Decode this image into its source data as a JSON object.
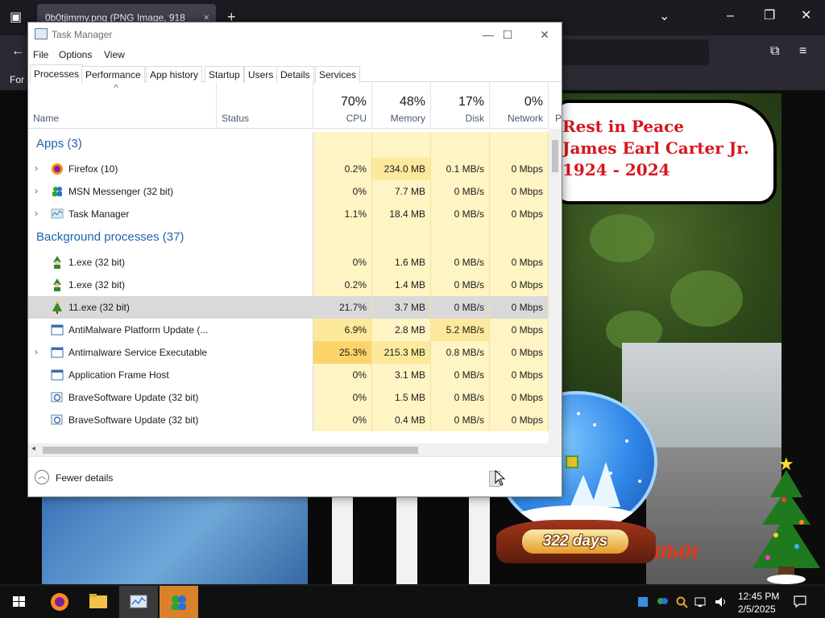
{
  "browser": {
    "tab_title": "0b0tjimmy.png (PNG Image, 918",
    "tab_close": "×",
    "new_tab": "+",
    "bookmark_text": "For"
  },
  "image": {
    "bubble_lines": [
      "Rest in Peace",
      "James Earl Carter Jr.",
      "1924 - 2024"
    ],
    "globe_label": "322 days",
    "signature": "0b0t"
  },
  "taskmgr": {
    "title": "Task Manager",
    "window_controls": {
      "minimize": "—",
      "maximize": "☐",
      "close": "✕"
    },
    "menu": [
      "File",
      "Options",
      "View"
    ],
    "tabs": [
      "Processes",
      "Performance",
      "App history",
      "Startup",
      "Users",
      "Details",
      "Services"
    ],
    "active_tab": "Processes",
    "header": {
      "sort_arrow": "^",
      "name": "Name",
      "status": "Status",
      "cpu": {
        "pct": "70%",
        "label": "CPU"
      },
      "memory": {
        "pct": "48%",
        "label": "Memory"
      },
      "disk": {
        "pct": "17%",
        "label": "Disk"
      },
      "network": {
        "pct": "0%",
        "label": "Network"
      },
      "power_partial": "P"
    },
    "groups": {
      "apps": "Apps (3)",
      "background": "Background processes (37)"
    },
    "apps": [
      {
        "name": "Firefox (10)",
        "cpu": "0.2%",
        "memory": "234.0 MB",
        "disk": "0.1 MB/s",
        "network": "0 Mbps",
        "expandable": true,
        "icon": "firefox-icon"
      },
      {
        "name": "MSN Messenger (32 bit)",
        "cpu": "0%",
        "memory": "7.7 MB",
        "disk": "0 MB/s",
        "network": "0 Mbps",
        "expandable": true,
        "icon": "msn-messenger-icon"
      },
      {
        "name": "Task Manager",
        "cpu": "1.1%",
        "memory": "18.4 MB",
        "disk": "0 MB/s",
        "network": "0 Mbps",
        "expandable": true,
        "icon": "task-manager-icon"
      }
    ],
    "background": [
      {
        "name": "1.exe (32 bit)",
        "cpu": "0%",
        "memory": "1.6 MB",
        "disk": "0 MB/s",
        "network": "0 Mbps",
        "expandable": false,
        "icon": "elf-icon"
      },
      {
        "name": "1.exe (32 bit)",
        "cpu": "0.2%",
        "memory": "1.4 MB",
        "disk": "0 MB/s",
        "network": "0 Mbps",
        "expandable": false,
        "icon": "elf-icon"
      },
      {
        "name": "11.exe (32 bit)",
        "cpu": "21.7%",
        "memory": "3.7 MB",
        "disk": "0 MB/s",
        "network": "0 Mbps",
        "expandable": false,
        "icon": "tree-icon",
        "selected": true
      },
      {
        "name": "AntiMalware Platform Update (...",
        "cpu": "6.9%",
        "memory": "2.8 MB",
        "disk": "5.2 MB/s",
        "network": "0 Mbps",
        "expandable": false,
        "icon": "window-icon"
      },
      {
        "name": "Antimalware Service Executable",
        "cpu": "25.3%",
        "memory": "215.3 MB",
        "disk": "0.8 MB/s",
        "network": "0 Mbps",
        "expandable": true,
        "icon": "window-icon"
      },
      {
        "name": "Application Frame Host",
        "cpu": "0%",
        "memory": "3.1 MB",
        "disk": "0 MB/s",
        "network": "0 Mbps",
        "expandable": false,
        "icon": "window-icon"
      },
      {
        "name": "BraveSoftware Update (32 bit)",
        "cpu": "0%",
        "memory": "1.5 MB",
        "disk": "0 MB/s",
        "network": "0 Mbps",
        "expandable": false,
        "icon": "updater-icon"
      },
      {
        "name": "BraveSoftware Update (32 bit)",
        "cpu": "0%",
        "memory": "0.4 MB",
        "disk": "0 MB/s",
        "network": "0 Mbps",
        "expandable": false,
        "icon": "updater-icon"
      }
    ],
    "footer": {
      "fewer_details": "Fewer details"
    }
  },
  "taskbar": {
    "time": "12:45 PM",
    "date": "2/5/2025"
  },
  "colors": {
    "heat_light": "#fff4c4",
    "heat_medium": "#fde99c",
    "heat_strong": "#fbd46a",
    "group_title": "#1e64b0"
  }
}
